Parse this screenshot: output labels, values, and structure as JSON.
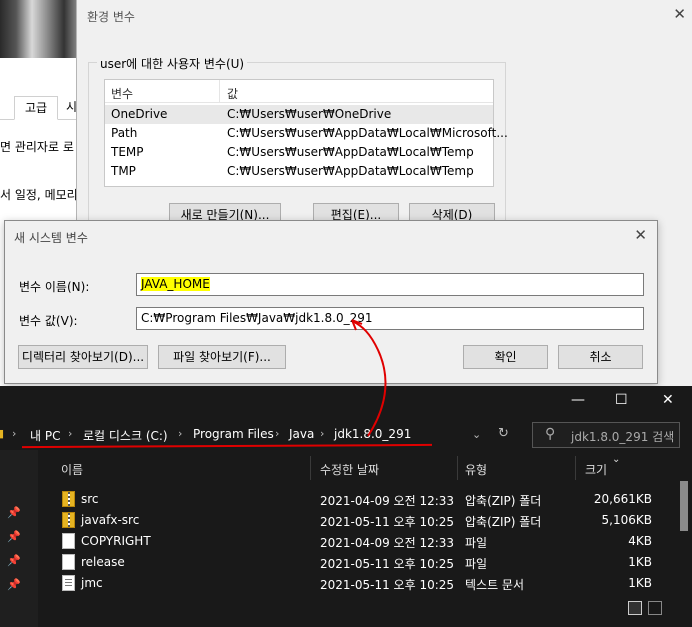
{
  "background_window": {
    "tabs": [
      "",
      "고급",
      "시"
    ],
    "lines": [
      "면 관리자로 로",
      "서 일정, 메모리"
    ]
  },
  "env_dialog": {
    "title": "환경 변수",
    "group_label": "user에 대한 사용자 변수(U)",
    "columns": [
      "변수",
      "값"
    ],
    "rows": [
      {
        "name": "OneDrive",
        "value": "C:₩Users₩user₩OneDrive"
      },
      {
        "name": "Path",
        "value": "C:₩Users₩user₩AppData₩Local₩Microsoft..."
      },
      {
        "name": "TEMP",
        "value": "C:₩Users₩user₩AppData₩Local₩Temp"
      },
      {
        "name": "TMP",
        "value": "C:₩Users₩user₩AppData₩Local₩Temp"
      }
    ],
    "buttons": {
      "new": "새로 만들기(N)...",
      "edit": "편집(E)...",
      "delete": "삭제(D)"
    }
  },
  "new_var_dialog": {
    "title": "새 시스템 변수",
    "name_label": "변수 이름(N):",
    "name_value": "JAVA_HOME",
    "value_label": "변수 값(V):",
    "value_value": "C:₩Program Files₩Java₩jdk1.8.0_291",
    "browse_dir": "디렉터리 찾아보기(D)...",
    "browse_file": "파일 찾아보기(F)...",
    "ok": "확인",
    "cancel": "취소"
  },
  "explorer": {
    "breadcrumbs": [
      "내 PC",
      "로컬 디스크 (C:)",
      "Program Files",
      "Java",
      "jdk1.8.0_291"
    ],
    "search_placeholder": "jdk1.8.0_291 검색",
    "columns": {
      "name": "이름",
      "modified": "수정한 날짜",
      "type": "유형",
      "size": "크기"
    },
    "files": [
      {
        "name": "src",
        "modified": "2021-04-09 오전 12:33",
        "type": "압축(ZIP) 폴더",
        "size": "20,661KB",
        "icon": "zip-folder-icon"
      },
      {
        "name": "javafx-src",
        "modified": "2021-05-11 오후 10:25",
        "type": "압축(ZIP) 폴더",
        "size": "5,106KB",
        "icon": "zip-folder-icon"
      },
      {
        "name": "COPYRIGHT",
        "modified": "2021-04-09 오전 12:33",
        "type": "파일",
        "size": "4KB",
        "icon": "file-icon"
      },
      {
        "name": "release",
        "modified": "2021-05-11 오후 10:25",
        "type": "파일",
        "size": "1KB",
        "icon": "file-icon"
      },
      {
        "name": "jmc",
        "modified": "2021-05-11 오후 10:25",
        "type": "텍스트 문서",
        "size": "1KB",
        "icon": "text-file-icon"
      }
    ]
  },
  "colors": {
    "highlight": "#ffff00",
    "annotation": "#e00000",
    "explorer_bg": "#191919"
  }
}
